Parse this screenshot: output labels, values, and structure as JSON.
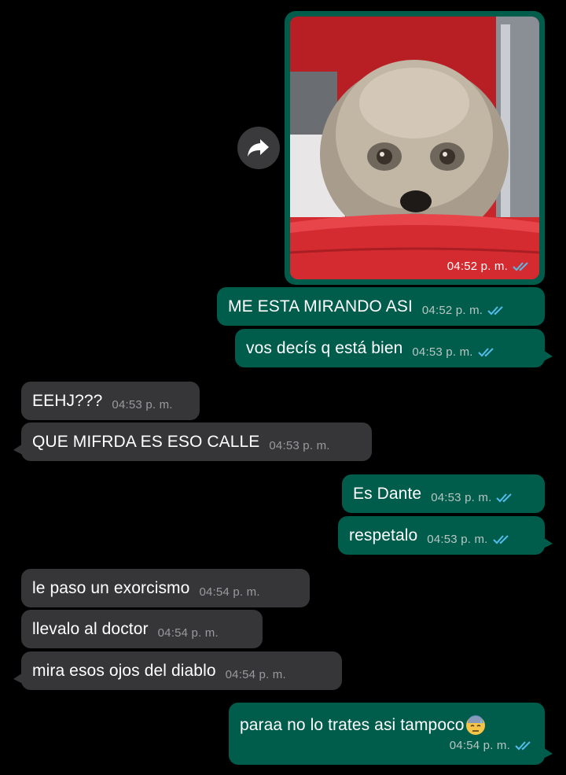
{
  "messages": {
    "m0": {
      "time": "04:52 p. m."
    },
    "m1": {
      "text": "ME ESTA MIRANDO ASI",
      "time": "04:52 p. m."
    },
    "m2": {
      "text": "vos decís q está bien",
      "time": "04:53 p. m."
    },
    "m3": {
      "text": "EEHJ???",
      "time": "04:53 p. m."
    },
    "m4": {
      "text": "QUE MIFRDA ES ESO CALLE",
      "time": "04:53 p. m."
    },
    "m5": {
      "text": "Es Dante",
      "time": "04:53 p. m."
    },
    "m6": {
      "text": "respetalo",
      "time": "04:53 p. m."
    },
    "m7": {
      "text": "le paso un exorcismo",
      "time": "04:54 p. m."
    },
    "m8": {
      "text": "llevalo al doctor",
      "time": "04:54 p. m."
    },
    "m9": {
      "text": "mira esos ojos del diablo",
      "time": "04:54 p. m."
    },
    "m10": {
      "text": "paraa no lo trates asi tampoco",
      "time": "04:54 p. m."
    }
  },
  "icons": {
    "forward": "forward-arrow-icon",
    "read_receipt": "double-check-icon",
    "emoji": "downcast-face-with-sweat-emoji"
  },
  "colors": {
    "outgoing_bubble": "#005c4b",
    "incoming_bubble": "#363638",
    "read_tick": "#53bdeb",
    "background": "#000000"
  }
}
